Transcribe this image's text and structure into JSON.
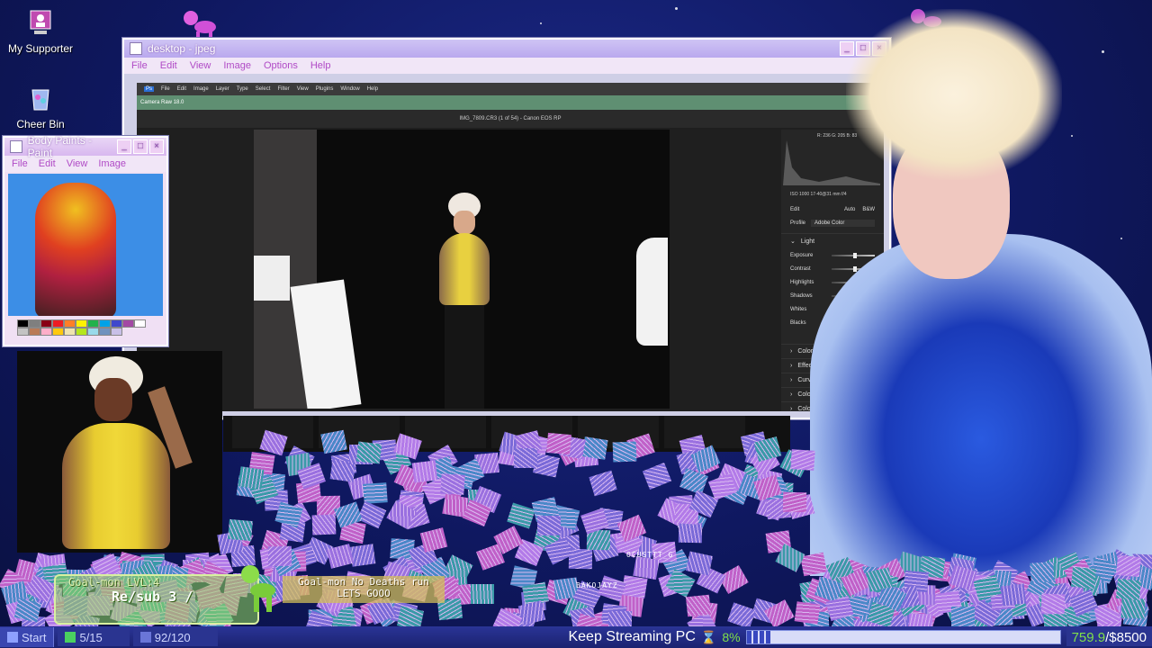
{
  "desktop": {
    "icons": [
      {
        "label": "My Supporter",
        "icon": "computer-user-icon"
      },
      {
        "label": "Cheer Bin",
        "icon": "recycle-bin-icon"
      }
    ]
  },
  "main_window": {
    "title": "desktop - jpeg",
    "menu": [
      "File",
      "Edit",
      "View",
      "Image",
      "Options",
      "Help"
    ],
    "photoshop": {
      "menu": [
        "File",
        "Edit",
        "Image",
        "Layer",
        "Type",
        "Select",
        "Filter",
        "View",
        "Plugins",
        "Window",
        "Help"
      ],
      "camera_raw_title": "Camera Raw 18.0",
      "image_title": "IMG_7809.CR3 (1 of 54)  -  Canon EOS RP",
      "rgb_readout": "R: 236   G: 205   B: 83",
      "camera_info": "ISO 1000      17-40@31 mm      f/4",
      "edit_label": "Edit",
      "auto_label": "Auto",
      "bw_label": "B&W",
      "profile_label": "Profile",
      "profile_value": "Adobe Color",
      "light_label": "Light",
      "sliders": [
        {
          "label": "Exposure",
          "value": 0.5
        },
        {
          "label": "Contrast",
          "value": 0.5
        },
        {
          "label": "Highlights",
          "value": 0.5
        },
        {
          "label": "Shadows",
          "value": 0.5
        },
        {
          "label": "Whites",
          "value": 0.5
        },
        {
          "label": "Blacks",
          "value": 0.5
        }
      ],
      "sections": [
        "Color",
        "Effects",
        "Curve",
        "Color Mixer",
        "Color Grading"
      ]
    }
  },
  "paint_window": {
    "title": "Body Paints - Paint",
    "menu": [
      "File",
      "Edit",
      "View",
      "Image"
    ],
    "palette": [
      "#000000",
      "#7f7f7f",
      "#880015",
      "#ed1c24",
      "#ff7f27",
      "#fff200",
      "#22b14c",
      "#00a2e8",
      "#3f48cc",
      "#a349a4",
      "#ffffff",
      "#c3c3c3",
      "#b97a57",
      "#ffaec9",
      "#ffc90e",
      "#efe4b0",
      "#b5e61d",
      "#99d9ea",
      "#7092be",
      "#c8bfe7"
    ]
  },
  "overlay": {
    "goal_title": "Goal-mon LVL:4",
    "goal_sub": "Re/sub 3 /",
    "goal2_line1": "Goal-mon No Deaths run",
    "goal2_line2": "LETS GOOO",
    "user1": "OCUSTTT_G",
    "user2": "BAKOJAYZ"
  },
  "taskbar": {
    "start": "Start",
    "counter1": "5/15",
    "counter2": "92/120",
    "title": "Keep Streaming PC",
    "percent": "8%",
    "progress": 0.08,
    "money_current": "759.9",
    "money_goal": "/$8500"
  },
  "colors": {
    "accent_pink": "#b04ac6",
    "goal_green": "#7fe04a",
    "taskbar_blue": "#1b2270"
  }
}
